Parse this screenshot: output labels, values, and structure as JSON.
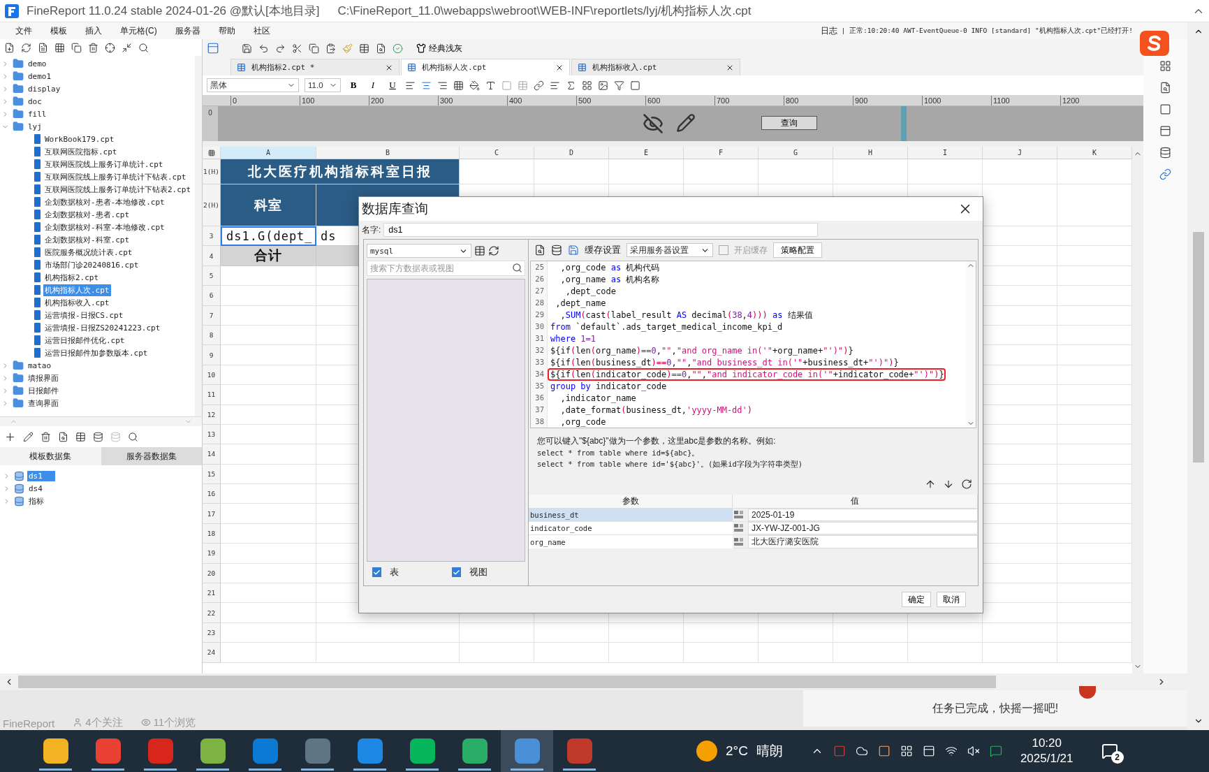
{
  "title_bar": {
    "app": "FineReport 11.0.24 stable 2024-01-26 @默认[本地目录]",
    "path": "C:\\FineReport_11.0\\webapps\\webroot\\WEB-INF\\reportlets/lyj/机构指标人次.cpt"
  },
  "menu": [
    "文件",
    "模板",
    "插入",
    "单元格(C)",
    "服务器",
    "帮助",
    "社区"
  ],
  "log": {
    "label": "日志",
    "message": "| 正常:10:20:40 AWT-EventQueue-0 INFO [standard] \"机构指标人次.cpt\"已经打开!"
  },
  "tree": [
    {
      "name": "demo",
      "kind": "folder",
      "expanded": false,
      "selected": false
    },
    {
      "name": "demo1",
      "kind": "folder",
      "expanded": false,
      "selected": false
    },
    {
      "name": "display",
      "kind": "folder",
      "expanded": false,
      "selected": false
    },
    {
      "name": "doc",
      "kind": "folder",
      "expanded": false,
      "selected": false
    },
    {
      "name": "fill",
      "kind": "folder",
      "expanded": false,
      "selected": false
    },
    {
      "name": "lyj",
      "kind": "folder",
      "expanded": true,
      "selected": false,
      "children": [
        {
          "name": "WorkBook179.cpt",
          "kind": "file",
          "selected": false
        },
        {
          "name": "互联网医院指标.cpt",
          "kind": "file",
          "selected": false
        },
        {
          "name": "互联网医院线上服务订单统计.cpt",
          "kind": "file",
          "selected": false
        },
        {
          "name": "互联网医院线上服务订单统计下钻表.cpt",
          "kind": "file",
          "selected": false
        },
        {
          "name": "互联网医院线上服务订单统计下钻表2.cpt",
          "kind": "file",
          "selected": false
        },
        {
          "name": "企划数据核对-患者-本地修改.cpt",
          "kind": "file",
          "selected": false
        },
        {
          "name": "企划数据核对-患者.cpt",
          "kind": "file",
          "selected": false
        },
        {
          "name": "企划数据核对-科室-本地修改.cpt",
          "kind": "file",
          "selected": false
        },
        {
          "name": "企划数据核对-科室.cpt",
          "kind": "file",
          "selected": false
        },
        {
          "name": "医院服务概况统计表.cpt",
          "kind": "file",
          "selected": false
        },
        {
          "name": "市场部门诊20240816.cpt",
          "kind": "file",
          "selected": false
        },
        {
          "name": "机构指标2.cpt",
          "kind": "file",
          "selected": false
        },
        {
          "name": "机构指标人次.cpt",
          "kind": "file",
          "selected": true
        },
        {
          "name": "机构指标收入.cpt",
          "kind": "file",
          "selected": false
        },
        {
          "name": "运营填报-日报CS.cpt",
          "kind": "file",
          "selected": false
        },
        {
          "name": "运营填报-日报ZS20241223.cpt",
          "kind": "file",
          "selected": false
        },
        {
          "name": "运营日报邮件优化.cpt",
          "kind": "file",
          "selected": false
        },
        {
          "name": "运营日报邮件加参数版本.cpt",
          "kind": "file",
          "selected": false
        }
      ]
    },
    {
      "name": "matao",
      "kind": "folder",
      "expanded": false,
      "selected": false
    },
    {
      "name": "填报界面",
      "kind": "folder",
      "expanded": false,
      "selected": false
    },
    {
      "name": "日报邮件",
      "kind": "folder",
      "expanded": false,
      "selected": false
    },
    {
      "name": "查询界面",
      "kind": "folder",
      "expanded": false,
      "selected": false
    }
  ],
  "dataset_tabs": [
    {
      "label": "模板数据集",
      "selected": true
    },
    {
      "label": "服务器数据集",
      "selected": false
    }
  ],
  "datasets": [
    {
      "name": "ds1",
      "selected": true
    },
    {
      "name": "ds4",
      "selected": false
    },
    {
      "name": "指标",
      "selected": false
    }
  ],
  "style_button": "经典浅灰",
  "tabs": [
    {
      "label": "机构指标2.cpt *",
      "selected": false
    },
    {
      "label": "机构指标人次.cpt",
      "selected": true
    },
    {
      "label": "机构指标收入.cpt",
      "selected": false
    }
  ],
  "font": {
    "family": "黑体",
    "size": "11.0"
  },
  "format_buttons": [
    "B",
    "I",
    "U"
  ],
  "ruler": [
    "0",
    "100",
    "200",
    "300",
    "400",
    "500",
    "600",
    "700",
    "800",
    "900",
    "1000",
    "1100",
    "1200"
  ],
  "vruler": "0",
  "query_button": "查询",
  "grid": {
    "columns": [
      "A",
      "B",
      "C",
      "D",
      "E",
      "F",
      "G",
      "H",
      "I",
      "J",
      "K"
    ],
    "rows": [
      {
        "label": "1(H)",
        "kind": "title",
        "cells": [
          {
            "text": "北大医疗机构指标科室日报",
            "kind": "title",
            "selected": false
          }
        ]
      },
      {
        "label": "2(H)",
        "kind": "header",
        "cells": [
          {
            "text": "科室",
            "kind": "header",
            "selected": false
          },
          {
            "kind": "header",
            "selected": false
          }
        ]
      },
      {
        "label": "3",
        "kind": "data",
        "cells": [
          {
            "text": "ds1.G(dept_",
            "kind": "text",
            "selected": true
          },
          {
            "text": "ds",
            "kind": "text",
            "selected": false
          }
        ]
      },
      {
        "label": "4",
        "kind": "data",
        "cells": [
          {
            "text": "合计",
            "kind": "total",
            "selected": false
          },
          {
            "kind": "total",
            "selected": false
          }
        ]
      },
      {
        "label": "5",
        "kind": "data"
      },
      {
        "label": "6",
        "kind": "data"
      },
      {
        "label": "7",
        "kind": "data"
      },
      {
        "label": "8",
        "kind": "data"
      },
      {
        "label": "9",
        "kind": "data"
      },
      {
        "label": "10",
        "kind": "data"
      },
      {
        "label": "11",
        "kind": "data"
      },
      {
        "label": "12",
        "kind": "data"
      },
      {
        "label": "13",
        "kind": "data"
      },
      {
        "label": "14",
        "kind": "data"
      },
      {
        "label": "15",
        "kind": "data"
      },
      {
        "label": "16",
        "kind": "data"
      },
      {
        "label": "17",
        "kind": "data"
      },
      {
        "label": "18",
        "kind": "data"
      },
      {
        "label": "19",
        "kind": "data"
      },
      {
        "label": "20",
        "kind": "data"
      },
      {
        "label": "21",
        "kind": "data"
      },
      {
        "label": "22",
        "kind": "data"
      },
      {
        "label": "23",
        "kind": "data"
      },
      {
        "label": "24",
        "kind": "data"
      }
    ]
  },
  "dialog": {
    "title": "数据库查询",
    "name_label": "名字:",
    "name_value": "ds1",
    "connection": "mysql",
    "search_placeholder": "搜索下方数据表或视图",
    "filters": [
      {
        "label": "表",
        "checked": true
      },
      {
        "label": "视图",
        "checked": true
      }
    ],
    "cache_label": "缓存设置",
    "cache_mode": "采用服务器设置",
    "cache_enable": {
      "label": "开启缓存",
      "checked": false,
      "disabled": true
    },
    "strategy_button": "策略配置",
    "code_lines": [
      {
        "number": "25",
        "highlighted": false,
        "tokens": [
          {
            "text": "  ,org_code ",
            "kind": "plain"
          },
          {
            "text": "as",
            "kind": "keyword"
          },
          {
            "text": " 机构代码",
            "kind": "plain"
          }
        ]
      },
      {
        "number": "26",
        "highlighted": false,
        "tokens": [
          {
            "text": "  ,org_name ",
            "kind": "plain"
          },
          {
            "text": "as",
            "kind": "keyword"
          },
          {
            "text": " 机构名称",
            "kind": "plain"
          }
        ]
      },
      {
        "number": "27",
        "highlighted": false,
        "tokens": [
          {
            "text": "   ,dept_code",
            "kind": "plain"
          }
        ]
      },
      {
        "number": "28",
        "highlighted": false,
        "tokens": [
          {
            "text": " ,dept_name",
            "kind": "plain"
          }
        ]
      },
      {
        "number": "29",
        "highlighted": false,
        "tokens": [
          {
            "text": "  ,",
            "kind": "plain"
          },
          {
            "text": "SUM",
            "kind": "keyword"
          },
          {
            "text": "(",
            "kind": "paren"
          },
          {
            "text": "cast",
            "kind": "plain"
          },
          {
            "text": "(",
            "kind": "paren"
          },
          {
            "text": "label_result ",
            "kind": "plain"
          },
          {
            "text": "AS",
            "kind": "keyword"
          },
          {
            "text": " decimal",
            "kind": "plain"
          },
          {
            "text": "(",
            "kind": "paren"
          },
          {
            "text": "38",
            "kind": "number"
          },
          {
            "text": ",",
            "kind": "plain"
          },
          {
            "text": "4",
            "kind": "number"
          },
          {
            "text": "))) ",
            "kind": "paren"
          },
          {
            "text": "as",
            "kind": "keyword"
          },
          {
            "text": " 结果值",
            "kind": "plain"
          }
        ]
      },
      {
        "number": "30",
        "highlighted": false,
        "tokens": [
          {
            "text": "from",
            "kind": "keyword"
          },
          {
            "text": " `default`.ads_target_medical_income_kpi_d",
            "kind": "plain"
          }
        ]
      },
      {
        "number": "31",
        "highlighted": false,
        "tokens": [
          {
            "text": "where ",
            "kind": "keyword"
          },
          {
            "text": "1=1",
            "kind": "number"
          }
        ]
      },
      {
        "number": "32",
        "highlighted": false,
        "tokens": [
          {
            "text": "${if",
            "kind": "plain"
          },
          {
            "text": "(",
            "kind": "paren"
          },
          {
            "text": "len",
            "kind": "plain"
          },
          {
            "text": "(",
            "kind": "paren"
          },
          {
            "text": "org_name",
            "kind": "plain"
          },
          {
            "text": ")==",
            "kind": "paren"
          },
          {
            "text": "0",
            "kind": "number"
          },
          {
            "text": ",",
            "kind": "plain"
          },
          {
            "text": "\"\"",
            "kind": "string"
          },
          {
            "text": ",",
            "kind": "plain"
          },
          {
            "text": "\"and org_name in('\"",
            "kind": "string"
          },
          {
            "text": "+org_name+",
            "kind": "plain"
          },
          {
            "text": "\"')\"",
            "kind": "string"
          },
          {
            "text": ")",
            "kind": "paren"
          },
          {
            "text": "}",
            "kind": "plain"
          }
        ]
      },
      {
        "number": "33",
        "highlighted": false,
        "tokens": [
          {
            "text": "${if",
            "kind": "plain"
          },
          {
            "text": "(",
            "kind": "paren"
          },
          {
            "text": "len",
            "kind": "plain"
          },
          {
            "text": "(",
            "kind": "paren"
          },
          {
            "text": "business_dt",
            "kind": "plain"
          },
          {
            "text": ")==",
            "kind": "paren"
          },
          {
            "text": "0",
            "kind": "number"
          },
          {
            "text": ",",
            "kind": "plain"
          },
          {
            "text": "\"\"",
            "kind": "string"
          },
          {
            "text": ",",
            "kind": "plain"
          },
          {
            "text": "\"and business_dt in('\"",
            "kind": "string"
          },
          {
            "text": "+business_dt+",
            "kind": "plain"
          },
          {
            "text": "\"')\"",
            "kind": "string"
          },
          {
            "text": ")",
            "kind": "paren"
          },
          {
            "text": "}",
            "kind": "plain"
          }
        ]
      },
      {
        "number": "34",
        "highlighted": true,
        "tokens": [
          {
            "text": "${if",
            "kind": "plain"
          },
          {
            "text": "(",
            "kind": "paren"
          },
          {
            "text": "len",
            "kind": "plain"
          },
          {
            "text": "(",
            "kind": "paren"
          },
          {
            "text": "indicator_code",
            "kind": "plain"
          },
          {
            "text": ")==",
            "kind": "paren"
          },
          {
            "text": "0",
            "kind": "number"
          },
          {
            "text": ",",
            "kind": "plain"
          },
          {
            "text": "\"\"",
            "kind": "string"
          },
          {
            "text": ",",
            "kind": "plain"
          },
          {
            "text": "\"and indicator_code in('\"",
            "kind": "string"
          },
          {
            "text": "+indicator_code+",
            "kind": "plain"
          },
          {
            "text": "\"')\"",
            "kind": "string"
          },
          {
            "text": ")",
            "kind": "paren"
          },
          {
            "text": "}",
            "kind": "plain"
          }
        ]
      },
      {
        "number": "35",
        "highlighted": false,
        "tokens": [
          {
            "text": "group by",
            "kind": "keyword"
          },
          {
            "text": " indicator_code",
            "kind": "plain"
          }
        ]
      },
      {
        "number": "36",
        "highlighted": false,
        "tokens": [
          {
            "text": "  ,indicator_name",
            "kind": "plain"
          }
        ]
      },
      {
        "number": "37",
        "highlighted": false,
        "tokens": [
          {
            "text": "  ,date_format",
            "kind": "plain"
          },
          {
            "text": "(",
            "kind": "paren"
          },
          {
            "text": "business_dt,",
            "kind": "plain"
          },
          {
            "text": "'yyyy-MM-dd'",
            "kind": "string"
          },
          {
            "text": ")",
            "kind": "paren"
          }
        ]
      },
      {
        "number": "38",
        "highlighted": false,
        "tokens": [
          {
            "text": "  ,org_code",
            "kind": "plain"
          }
        ]
      }
    ],
    "help": [
      "您可以键入\"${abc}\"做为一个参数，这里abc是参数的名称。例如:",
      "select * from table where id=${abc}。",
      "select * from table where id='${abc}'。(如果id字段为字符串类型)"
    ],
    "param_headers": [
      "参数",
      "值"
    ],
    "params": [
      {
        "name": "business_dt",
        "value": "2025-01-19",
        "selected": true
      },
      {
        "name": "indicator_code",
        "value": "JX-YW-JZ-001-JG",
        "selected": false
      },
      {
        "name": "org_name",
        "value": "北大医疗潞安医院",
        "selected": false
      }
    ],
    "buttons": [
      "确定",
      "取消"
    ]
  },
  "page_footer": {
    "author": "FineReport",
    "follows": "4个关注",
    "views": "11个浏览",
    "toast": "任务已完成，快摇一摇吧!"
  },
  "taskbar": {
    "apps": [
      {
        "color": "#f2b322",
        "selected": false
      },
      {
        "color": "#e94235",
        "selected": false
      },
      {
        "color": "#d9261c",
        "selected": false
      },
      {
        "color": "#7cb342",
        "selected": false
      },
      {
        "color": "#0a7ad4",
        "selected": false
      },
      {
        "color": "#5f7583",
        "selected": false
      },
      {
        "color": "#1e88e5",
        "selected": false
      },
      {
        "color": "#07b55c",
        "selected": false
      },
      {
        "color": "#2aae67",
        "selected": false
      },
      {
        "color": "#4a90d9",
        "selected": true
      },
      {
        "color": "#c0392b",
        "selected": false
      }
    ],
    "temperature": "2°C",
    "weather": "晴朗",
    "time": "10:20",
    "date": "2025/1/21",
    "notifications": "2"
  }
}
